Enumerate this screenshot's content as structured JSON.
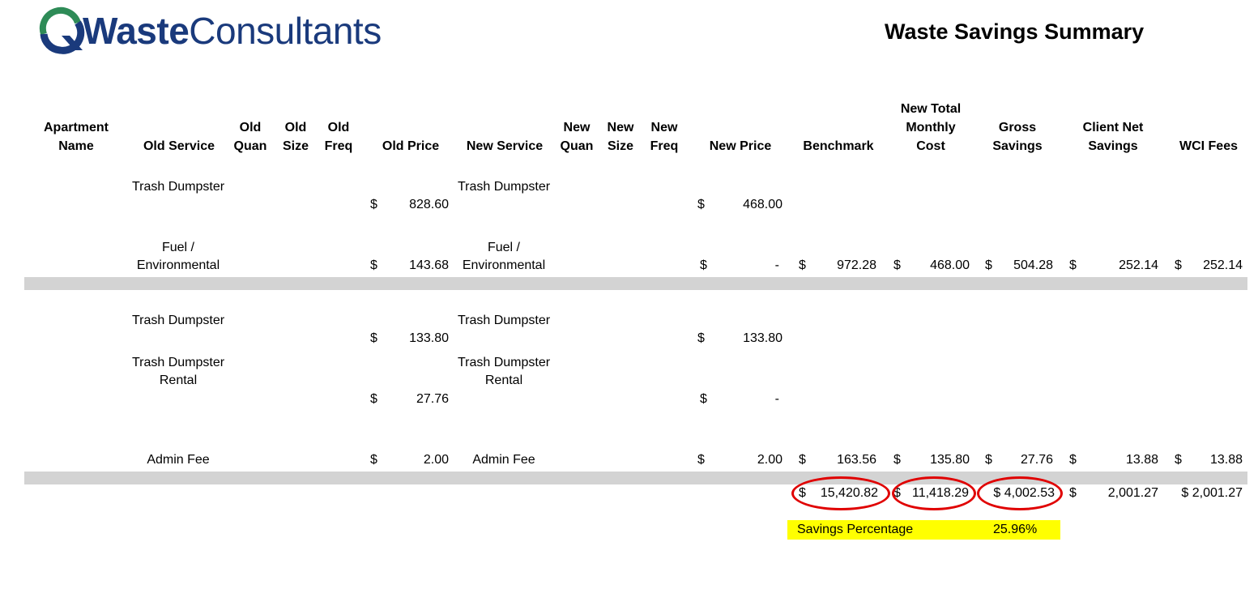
{
  "logo": {
    "bold": "Waste",
    "regular": "Consultants"
  },
  "title": "Waste Savings Summary",
  "headers": {
    "apartment": "Apartment Name",
    "old_service": "Old Service",
    "old_quan": "Old Quan",
    "old_size": "Old Size",
    "old_freq": "Old Freq",
    "old_price": "Old Price",
    "new_service": "New Service",
    "new_quan": "New Quan",
    "new_size": "New Size",
    "new_freq": "New Freq",
    "new_price": "New Price",
    "benchmark": "Benchmark",
    "new_total": "New Total Monthly Cost",
    "gross": "Gross Savings",
    "client_net": "Client Net Savings",
    "wci_fees": "WCI Fees"
  },
  "currency": "$",
  "rows": [
    {
      "old_service": "Trash Dumpster",
      "old_price": "828.60",
      "new_service": "Trash Dumpster",
      "new_price": "468.00"
    },
    {
      "old_service": "Fuel / Environmental",
      "old_price": "143.68",
      "new_service": "Fuel / Environmental",
      "new_price": "-",
      "benchmark": "972.28",
      "new_total": "468.00",
      "gross": "504.28",
      "client_net": "252.14",
      "wci": "252.14"
    },
    {
      "old_service": "Trash Dumpster",
      "old_price": "133.80",
      "new_service": "Trash Dumpster",
      "new_price": "133.80"
    },
    {
      "old_service": "Trash Dumpster Rental",
      "old_price": "27.76",
      "new_service": "Trash Dumpster Rental",
      "new_price": "-"
    },
    {
      "old_service": "Admin Fee",
      "old_price": "2.00",
      "new_service": "Admin Fee",
      "new_price": "2.00",
      "benchmark": "163.56",
      "new_total": "135.80",
      "gross": "27.76",
      "client_net": "13.88",
      "wci": "13.88"
    }
  ],
  "totals": {
    "benchmark": "15,420.82",
    "new_total": "11,418.29",
    "gross": "$ 4,002.53",
    "client_net": "2,001.27",
    "wci": "$ 2,001.27"
  },
  "savings": {
    "label": "Savings Percentage",
    "value": "25.96%"
  },
  "colors": {
    "logo_text": "#1a3a7c",
    "highlight": "#ffff00",
    "circle": "#e00000",
    "band": "#d3d3d3"
  }
}
